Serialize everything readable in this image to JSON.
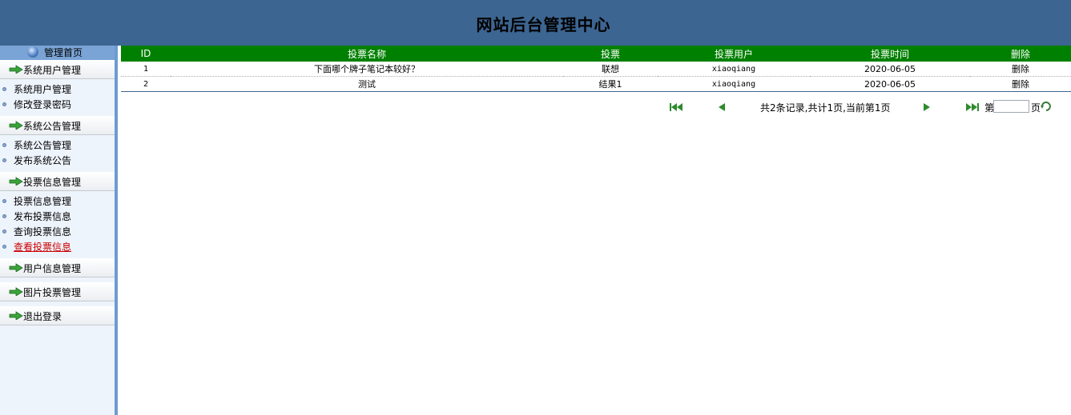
{
  "header": {
    "title": "网站后台管理中心"
  },
  "sidebar": {
    "home_label": "管理首页",
    "groups": [
      {
        "title": "系统用户管理",
        "items": [
          "系统用户管理",
          "修改登录密码"
        ]
      },
      {
        "title": "系统公告管理",
        "items": [
          "系统公告管理",
          "发布系统公告"
        ]
      },
      {
        "title": "投票信息管理",
        "items": [
          "投票信息管理",
          "发布投票信息",
          "查询投票信息",
          "查看投票信息"
        ]
      },
      {
        "title": "用户信息管理",
        "items": []
      },
      {
        "title": "图片投票管理",
        "items": []
      },
      {
        "title": "退出登录",
        "items": []
      }
    ],
    "active_item": "查看投票信息"
  },
  "table": {
    "columns": [
      "ID",
      "投票名称",
      "投票",
      "投票用户",
      "投票时间",
      "删除"
    ],
    "rows": [
      {
        "id": "1",
        "name": "下面哪个牌子笔记本较好？",
        "vote": "联想",
        "user": "xiaoqiang",
        "time": "2020-06-05",
        "delete": "删除"
      },
      {
        "id": "2",
        "name": "测试",
        "vote": "结果1",
        "user": "xiaoqiang",
        "time": "2020-06-05",
        "delete": "删除"
      }
    ]
  },
  "pager": {
    "info": "共2条记录,共计1页,当前第1页",
    "page_prefix": "第",
    "page_suffix": "页",
    "page_value": ""
  },
  "colors": {
    "header_bg": "#3c6591",
    "table_header_bg": "#008000",
    "active_link": "#cc0000"
  }
}
